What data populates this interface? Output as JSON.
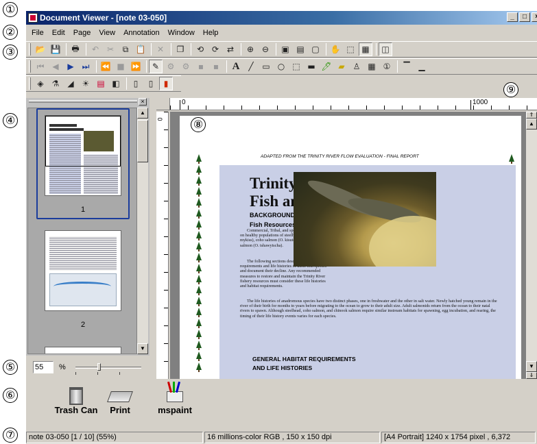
{
  "window": {
    "title": "Document Viewer - [note 03-050]",
    "minimize": "_",
    "maximize": "□",
    "close": "×"
  },
  "callouts": [
    "①",
    "②",
    "③",
    "④",
    "⑤",
    "⑥",
    "⑦",
    "⑧",
    "⑨"
  ],
  "menu": [
    "File",
    "Edit",
    "Page",
    "View",
    "Annotation",
    "Window",
    "Help"
  ],
  "thumbnails": {
    "page1_label": "1",
    "page2_label": "2",
    "close": "×"
  },
  "zoom": {
    "value": "55",
    "unit": "%"
  },
  "ruler": {
    "origin": "0",
    "mark1000": "1000"
  },
  "document": {
    "header": "ADAPTED FROM THE TRINITY RIVER FLOW EVALUATION - FINAL REPORT",
    "title1": "Trinity River",
    "title2": "Fish and Wildlife",
    "section1": "BACKGROUND",
    "subsection1": "Fish Resources",
    "para1": "Commercial, Tribal, and sport fisheries depend on healthy populations of steelhead (Oncorhynchus mykiss), coho salmon (O. kisutch), and chinook salmon (O. tshawytscha).",
    "para2": "The following sections describe the habitat requirements and life histories of these fish species and document their decline. Any recommended measures to restore and maintain the Trinity River fishery resources must consider these life histories and habitat requirements.",
    "para3": "The life histories of anadromous species have two distinct phases, one in freshwater and the other in salt water. Newly hatched young remain in the river of their birth for months to years before migrating to the ocean to grow to their adult size. Adult salmonids return from the ocean to their natal rivers to spawn. Although steelhead, coho salmon, and chinook salmon require similar instream habitats for spawning, egg incubation, and rearing, the timing of their life history events varies for each species.",
    "section2": "GENERAL HABITAT REQUIREMENTS",
    "section2b": "AND LIFE HISTORIES"
  },
  "desktop_icons": [
    {
      "name": "trash-can",
      "label": "Trash Can"
    },
    {
      "name": "print",
      "label": "Print"
    },
    {
      "name": "mspaint",
      "label": "mspaint"
    }
  ],
  "status": {
    "doc": "note 03-050 [1 / 10] (55%)",
    "color": "16 millions-color RGB ,  150 x 150 dpi",
    "size": "[A4 Portrait]  1240 x 1754 pixel , 6,372"
  }
}
